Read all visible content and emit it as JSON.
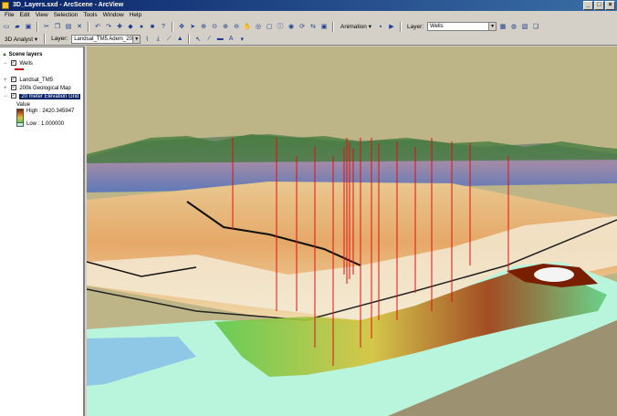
{
  "window": {
    "title": "3D_Layers.sxd - ArcScene - ArcView",
    "controls": [
      "_",
      "□",
      "×"
    ]
  },
  "menu": [
    "File",
    "Edit",
    "View",
    "Selection",
    "Tools",
    "Window",
    "Help"
  ],
  "toolbar1": {
    "animation_label": "Animation ▾",
    "layer_label": "Layer:",
    "layer_value": "Wells"
  },
  "toolbar2": {
    "analyst_label": "3D Analyst ▾",
    "layer_label": "Layer:",
    "layer_value": "Landsat_TM5 Adem_20m_"
  },
  "toc": {
    "root": "Scene layers",
    "layers": [
      {
        "name": "Wells",
        "checked": true
      },
      {
        "name": "Landsat_TM5",
        "checked": true
      },
      {
        "name": "200k Geological Map",
        "checked": true
      },
      {
        "name": "20 meter Elevation Grid",
        "checked": true,
        "selected": true
      }
    ],
    "legend_title": "Value",
    "high": "High : 2420.345947",
    "low": "Low : 1.000000"
  },
  "colors": {
    "sky": "#bdb487",
    "water": "#8fc7e6",
    "terrain_high": "#7a1e00",
    "terrain_low": "#b8f5dc",
    "wells": "#e01010"
  }
}
